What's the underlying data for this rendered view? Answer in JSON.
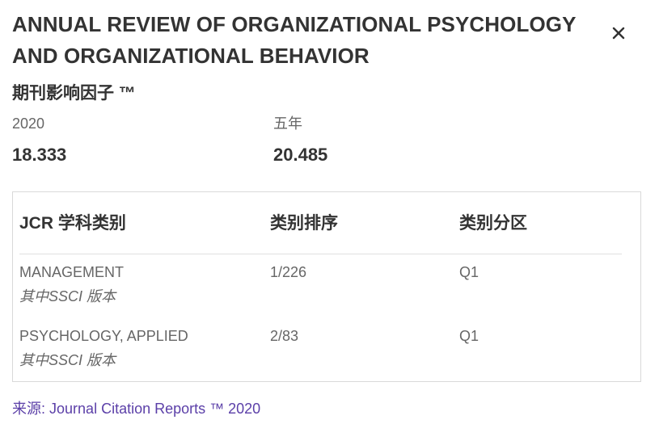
{
  "journal": {
    "title_line1": "ANNUAL REVIEW OF ORGANIZATIONAL PSYCHOLOGY",
    "title_line2": "AND ORGANIZATIONAL BEHAVIOR"
  },
  "close_icon": "close-x-icon",
  "impact_factor": {
    "heading": "期刊影响因子 ™",
    "metrics": [
      {
        "label": "2020",
        "value": "18.333"
      },
      {
        "label": "五年",
        "value": "20.485"
      }
    ]
  },
  "jcr": {
    "headers": [
      "JCR 学科类别",
      "类别排序",
      "类别分区"
    ],
    "rows": [
      {
        "category": "MANAGEMENT",
        "edition": "其中SSCI 版本",
        "rank": "1/226",
        "quartile": "Q1"
      },
      {
        "category": "PSYCHOLOGY, APPLIED",
        "edition": "其中SSCI 版本",
        "rank": "2/83",
        "quartile": "Q1"
      }
    ]
  },
  "source": {
    "prefix": "来源:",
    "link_text": "Journal Citation Reports ™ 2020"
  },
  "colors": {
    "text_primary": "#333333",
    "text_secondary": "#666666",
    "link": "#5b3fa8",
    "border": "#d9d9d9"
  }
}
